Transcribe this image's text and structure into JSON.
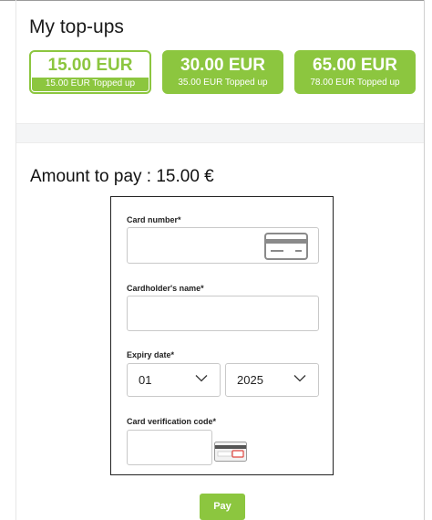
{
  "section_title": "My top-ups",
  "topups": [
    {
      "amount": "15.00 EUR",
      "note": "15.00 EUR Topped up",
      "selected": true
    },
    {
      "amount": "30.00 EUR",
      "note": "35.00 EUR Topped up",
      "selected": false
    },
    {
      "amount": "65.00 EUR",
      "note": "78.00 EUR Topped up",
      "selected": false
    }
  ],
  "amount_to_pay": "Amount to pay : 15.00 €",
  "form": {
    "card_number_label": "Card number*",
    "cardholder_label": "Cardholder's name*",
    "expiry_label": "Expiry date*",
    "expiry_month": "01",
    "expiry_year": "2025",
    "cvc_label": "Card verification code*"
  },
  "pay_button": "Pay",
  "colors": {
    "accent": "#8cc63f"
  },
  "icons": [
    "card-icon",
    "chevron-down-icon",
    "cvc-card-icon"
  ]
}
